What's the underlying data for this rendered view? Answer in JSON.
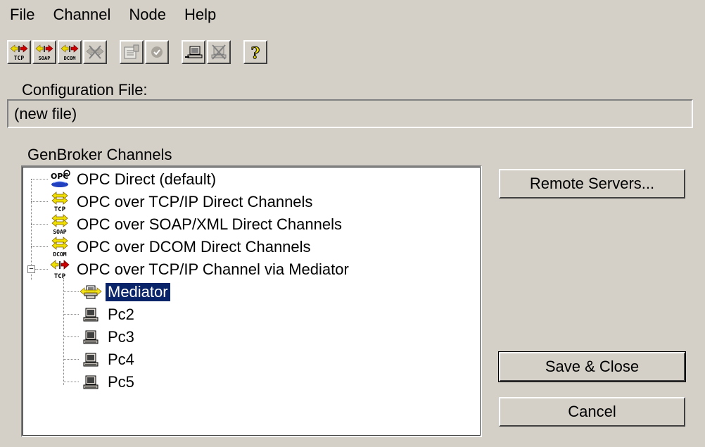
{
  "menu": [
    {
      "label": "File"
    },
    {
      "label": "Channel"
    },
    {
      "label": "Node"
    },
    {
      "label": "Help"
    }
  ],
  "toolbar": {
    "buttons": [
      {
        "icon": "tcp-channel-icon",
        "caption": "TCP"
      },
      {
        "icon": "soap-channel-icon",
        "caption": "SOAP"
      },
      {
        "icon": "dcom-channel-icon",
        "caption": "DCOM"
      },
      {
        "icon": "delete-channel-icon",
        "caption": ""
      },
      {
        "icon": "properties-icon",
        "caption": ""
      },
      {
        "icon": "check-icon",
        "caption": ""
      },
      {
        "icon": "add-node-icon",
        "caption": ""
      },
      {
        "icon": "delete-node-icon",
        "caption": ""
      },
      {
        "icon": "help-icon",
        "caption": "?"
      }
    ]
  },
  "config": {
    "label": "Configuration File:",
    "value": "(new file)"
  },
  "channels": {
    "label": "GenBroker Channels",
    "items": [
      {
        "label": "OPC Direct (default)",
        "icon": "opc-icon"
      },
      {
        "label": "OPC over TCP/IP Direct Channels",
        "icon": "tcp-arrows-icon",
        "caption": "TCP"
      },
      {
        "label": "OPC over SOAP/XML Direct Channels",
        "icon": "soap-arrows-icon",
        "caption": "SOAP"
      },
      {
        "label": "OPC over DCOM Direct Channels",
        "icon": "dcom-arrows-icon",
        "caption": "DCOM"
      },
      {
        "label": "OPC over TCP/IP Channel via Mediator",
        "icon": "tcp-mediator-icon",
        "caption": "TCP",
        "expanded": true
      },
      {
        "label": "Mediator",
        "icon": "mediator-icon",
        "selected": true
      },
      {
        "label": "Pc2",
        "icon": "computer-icon"
      },
      {
        "label": "Pc3",
        "icon": "computer-icon"
      },
      {
        "label": "Pc4",
        "icon": "computer-icon"
      },
      {
        "label": "Pc5",
        "icon": "computer-icon"
      }
    ],
    "expander_symbol": "−"
  },
  "buttons": {
    "remote_servers": "Remote Servers...",
    "save_close": "Save & Close",
    "cancel": "Cancel"
  },
  "colors": {
    "face": "#d4d0c8",
    "selection": "#0a246a",
    "arrow_yellow": "#f0e000",
    "arrow_red": "#cc0000"
  }
}
